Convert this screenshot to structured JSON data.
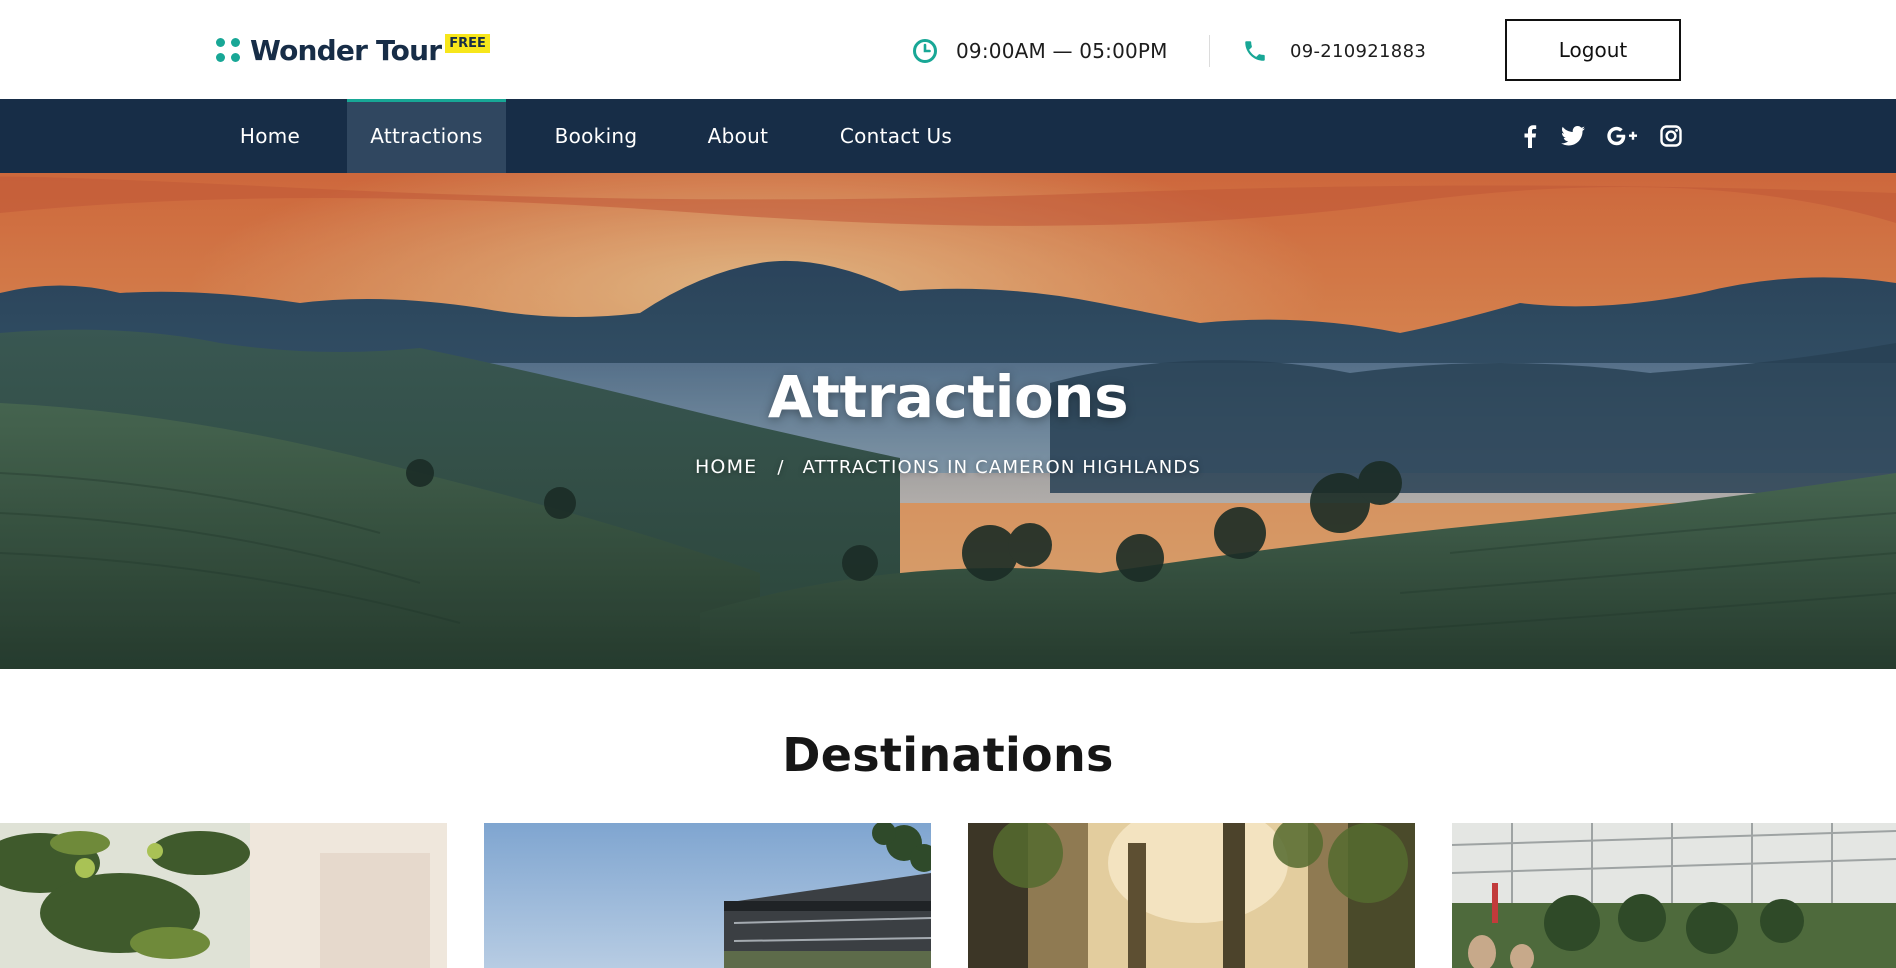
{
  "brand": {
    "name": "Wonder Tour",
    "badge": "FREE"
  },
  "header": {
    "hours": "09:00AM — 05:00PM",
    "phone": "09-210921883",
    "logout_label": "Logout",
    "accent_color": "#18a796"
  },
  "nav": {
    "items": [
      {
        "label": "Home",
        "active": false
      },
      {
        "label": "Attractions",
        "active": true
      },
      {
        "label": "Booking",
        "active": false
      },
      {
        "label": "About",
        "active": false
      },
      {
        "label": "Contact Us",
        "active": false
      }
    ],
    "social_icons": [
      "facebook-icon",
      "twitter-icon",
      "google-plus-icon",
      "instagram-icon"
    ],
    "background_color": "#172d47"
  },
  "hero": {
    "title": "Attractions",
    "breadcrumb": {
      "home": "HOME",
      "separator": "/",
      "current": "ATTRACTIONS IN CAMERON HIGHLANDS"
    }
  },
  "destinations": {
    "heading": "Destinations"
  }
}
